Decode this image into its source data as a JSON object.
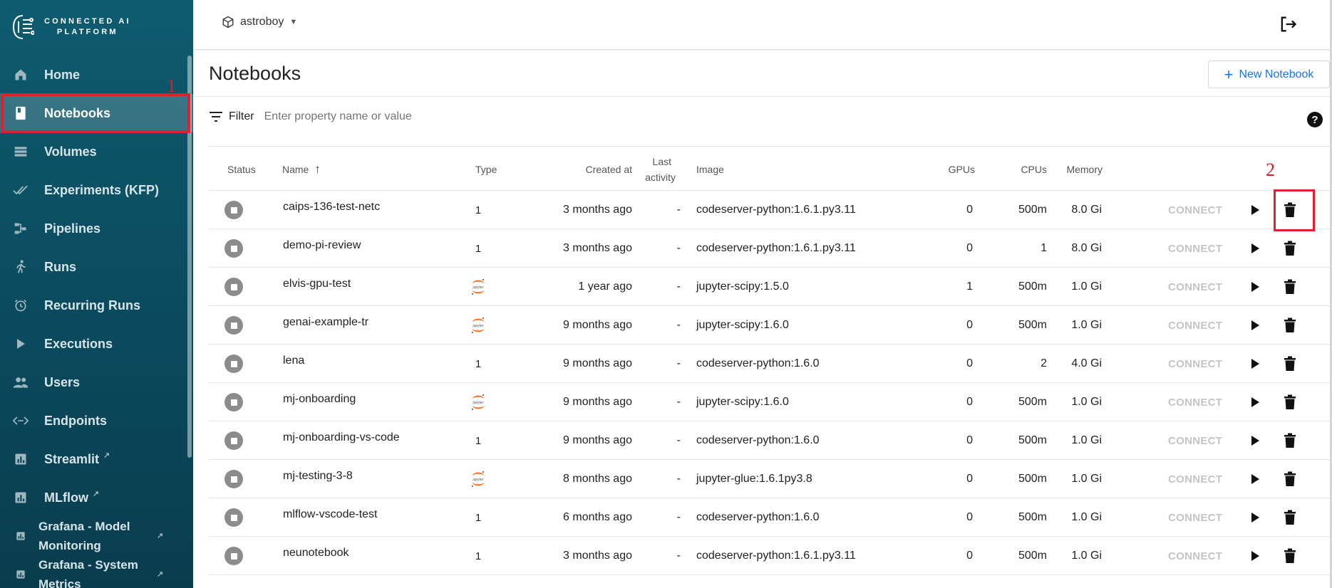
{
  "brand": {
    "line1": "CONNECTED AI",
    "line2": "PLATFORM"
  },
  "sidebar": {
    "items": [
      {
        "label": "Home",
        "icon": "home-icon",
        "active": false
      },
      {
        "label": "Notebooks",
        "icon": "book-icon",
        "active": true
      },
      {
        "label": "Volumes",
        "icon": "storage-icon",
        "active": false
      },
      {
        "label": "Experiments (KFP)",
        "icon": "checks-icon",
        "active": false
      },
      {
        "label": "Pipelines",
        "icon": "pipeline-icon",
        "active": false
      },
      {
        "label": "Runs",
        "icon": "run-icon",
        "active": false
      },
      {
        "label": "Recurring Runs",
        "icon": "alarm-icon",
        "active": false
      },
      {
        "label": "Executions",
        "icon": "play-icon",
        "active": false
      },
      {
        "label": "Users",
        "icon": "people-icon",
        "active": false
      },
      {
        "label": "Endpoints",
        "icon": "code-icon",
        "active": false
      },
      {
        "label": "Streamlit",
        "icon": "chart-icon",
        "active": false,
        "external": true
      },
      {
        "label": "MLflow",
        "icon": "chart-icon",
        "active": false,
        "external": true
      },
      {
        "label": "Grafana - Model Monitoring",
        "icon": "chart-icon",
        "active": false,
        "external": true
      },
      {
        "label": "Grafana - System Metrics",
        "icon": "chart-icon",
        "active": false,
        "external": true
      }
    ]
  },
  "annotations": {
    "first": "1",
    "second": "2"
  },
  "header": {
    "namespace": "astroboy"
  },
  "page": {
    "title": "Notebooks",
    "new_button": "New Notebook"
  },
  "filter": {
    "label": "Filter",
    "placeholder": "Enter property name or value"
  },
  "help": "?",
  "table": {
    "columns": {
      "status": "Status",
      "name": "Name",
      "type": "Type",
      "created": "Created at",
      "last_activity_1": "Last",
      "last_activity_2": "activity",
      "image": "Image",
      "gpus": "GPUs",
      "cpus": "CPUs",
      "memory": "Memory"
    },
    "connect_label": "CONNECT",
    "rows": [
      {
        "name": "caips-136-test-netc",
        "type": "1",
        "type_icon": "",
        "created": "3 months ago",
        "last": "-",
        "image": "codeserver-python:1.6.1.py3.11",
        "gpus": "0",
        "cpus": "500m",
        "memory": "8.0 Gi"
      },
      {
        "name": "demo-pi-review",
        "type": "1",
        "type_icon": "",
        "created": "3 months ago",
        "last": "-",
        "image": "codeserver-python:1.6.1.py3.11",
        "gpus": "0",
        "cpus": "1",
        "memory": "8.0 Gi"
      },
      {
        "name": "elvis-gpu-test",
        "type": "",
        "type_icon": "jupyter-icon",
        "created": "1 year ago",
        "last": "-",
        "image": "jupyter-scipy:1.5.0",
        "gpus": "1",
        "cpus": "500m",
        "memory": "1.0 Gi"
      },
      {
        "name": "genai-example-tr",
        "type": "",
        "type_icon": "jupyter-icon",
        "created": "9 months ago",
        "last": "-",
        "image": "jupyter-scipy:1.6.0",
        "gpus": "0",
        "cpus": "500m",
        "memory": "1.0 Gi"
      },
      {
        "name": "lena",
        "type": "1",
        "type_icon": "",
        "created": "9 months ago",
        "last": "-",
        "image": "codeserver-python:1.6.0",
        "gpus": "0",
        "cpus": "2",
        "memory": "4.0 Gi"
      },
      {
        "name": "mj-onboarding",
        "type": "",
        "type_icon": "jupyter-icon",
        "created": "9 months ago",
        "last": "-",
        "image": "jupyter-scipy:1.6.0",
        "gpus": "0",
        "cpus": "500m",
        "memory": "1.0 Gi"
      },
      {
        "name": "mj-onboarding-vs-code",
        "type": "1",
        "type_icon": "",
        "created": "9 months ago",
        "last": "-",
        "image": "codeserver-python:1.6.0",
        "gpus": "0",
        "cpus": "500m",
        "memory": "1.0 Gi"
      },
      {
        "name": "mj-testing-3-8",
        "type": "",
        "type_icon": "jupyter-icon",
        "created": "8 months ago",
        "last": "-",
        "image": "jupyter-glue:1.6.1py3.8",
        "gpus": "0",
        "cpus": "500m",
        "memory": "1.0 Gi"
      },
      {
        "name": "mlflow-vscode-test",
        "type": "1",
        "type_icon": "",
        "created": "6 months ago",
        "last": "-",
        "image": "codeserver-python:1.6.0",
        "gpus": "0",
        "cpus": "500m",
        "memory": "1.0 Gi"
      },
      {
        "name": "neunotebook",
        "type": "1",
        "type_icon": "",
        "created": "3 months ago",
        "last": "-",
        "image": "codeserver-python:1.6.1.py3.11",
        "gpus": "0",
        "cpus": "500m",
        "memory": "1.0 Gi"
      }
    ]
  },
  "colors": {
    "sidebar": "#0e5b6f",
    "accent": "#1a73e8",
    "annotation": "#e0202f"
  }
}
